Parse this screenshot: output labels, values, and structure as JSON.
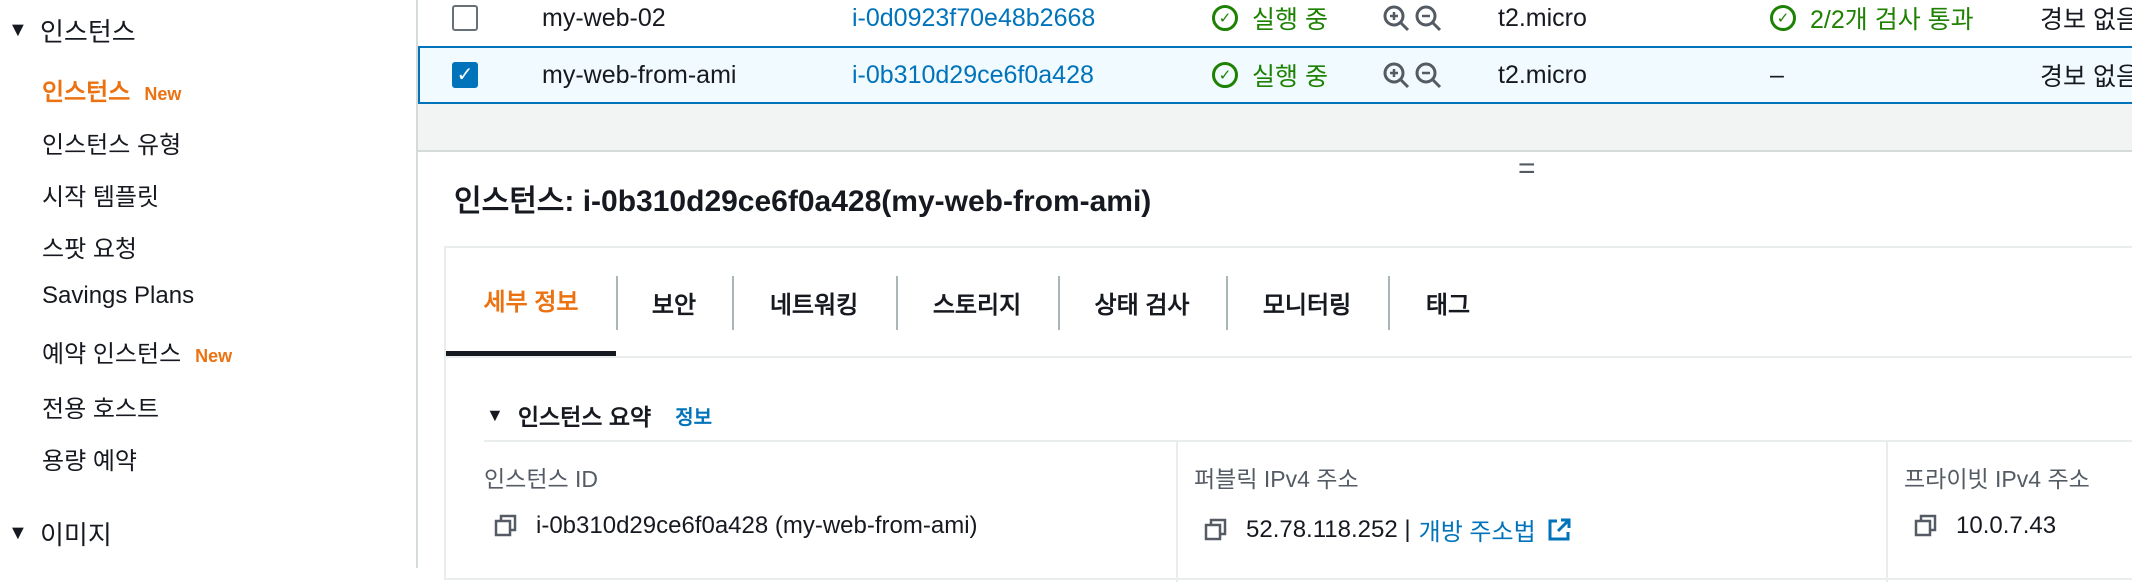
{
  "sidebar": {
    "section_instances": "인스턴스",
    "items": [
      {
        "label": "인스턴스",
        "badge": "New",
        "active": true
      },
      {
        "label": "인스턴스 유형"
      },
      {
        "label": "시작 템플릿"
      },
      {
        "label": "스팟 요청"
      },
      {
        "label": "Savings Plans"
      },
      {
        "label": "예약 인스턴스",
        "badge": "New"
      },
      {
        "label": "전용 호스트"
      },
      {
        "label": "용량 예약"
      }
    ],
    "section_images": "이미지"
  },
  "table": {
    "rows": [
      {
        "name": "my-web-02",
        "id": "i-0d0923f70e48b2668",
        "state": "실행 중",
        "type": "t2.micro",
        "check": "2/2개 검사 통과",
        "alarm": "경보 없음",
        "checked": false
      },
      {
        "name": "my-web-from-ami",
        "id": "i-0b310d29ce6f0a428",
        "state": "실행 중",
        "type": "t2.micro",
        "check": "–",
        "alarm": "경보 없음",
        "checked": true
      }
    ]
  },
  "detail": {
    "title": "인스턴스: i-0b310d29ce6f0a428(my-web-from-ami)",
    "tabs": [
      "세부 정보",
      "보안",
      "네트워킹",
      "스토리지",
      "상태 검사",
      "모니터링",
      "태그"
    ],
    "summary_label": "인스턴스 요약",
    "summary_info": "정보",
    "fields": {
      "instance_id_label": "인스턴스 ID",
      "instance_id_value": "i-0b310d29ce6f0a428 (my-web-from-ami)",
      "public_ip_label": "퍼블릭 IPv4 주소",
      "public_ip_value": "52.78.118.252 |",
      "public_ip_link": "개방 주소법",
      "private_ip_label": "프라이빗 IPv4 주소",
      "private_ip_value": "10.0.7.43"
    }
  },
  "colors": {
    "accent": "#ec7211",
    "link": "#0073bb",
    "success": "#1d8102"
  }
}
